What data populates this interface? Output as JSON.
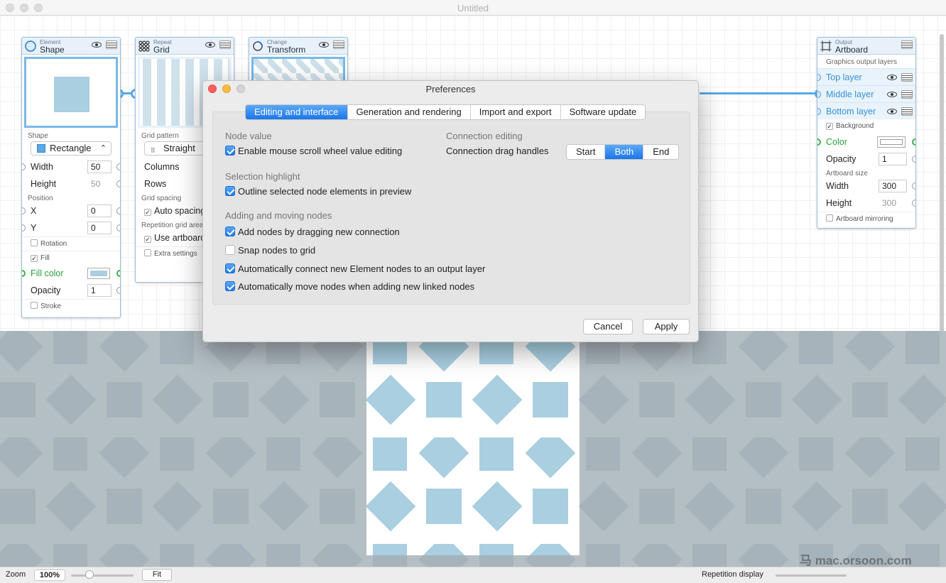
{
  "window": {
    "title": "Untitled"
  },
  "nodes": {
    "shape": {
      "category": "Element",
      "name": "Shape",
      "section_shape": "Shape",
      "shape_value": "Rectangle",
      "width_label": "Width",
      "width_value": "50",
      "height_label": "Height",
      "height_value": "50",
      "section_position": "Position",
      "x_label": "X",
      "x_value": "0",
      "y_label": "Y",
      "y_value": "0",
      "rotation_label": "Rotation",
      "fill_label": "Fill",
      "fill_color_label": "Fill color",
      "opacity_label": "Opacity",
      "opacity_value": "1",
      "stroke_label": "Stroke",
      "accent_color": "#a9cfe0"
    },
    "grid": {
      "category": "Repeat",
      "name": "Grid",
      "section_pattern": "Grid pattern",
      "pattern_value": "Straight",
      "columns_label": "Columns",
      "rows_label": "Rows",
      "section_spacing": "Grid spacing",
      "auto_spacing_label": "Auto spacing",
      "section_repetition": "Repetition grid area",
      "use_artboard_label": "Use artboard",
      "extra_settings_label": "Extra settings"
    },
    "transform": {
      "category": "Change",
      "name": "Transform"
    },
    "artboard": {
      "category": "Output",
      "name": "Artboard",
      "section_layers": "Graphics output layers",
      "layers": [
        "Top layer",
        "Middle layer",
        "Bottom layer"
      ],
      "background_label": "Background",
      "color_label": "Color",
      "opacity_label": "Opacity",
      "opacity_value": "1",
      "section_size": "Artboard size",
      "width_label": "Width",
      "width_value": "300",
      "height_label": "Height",
      "height_value": "300",
      "mirroring_label": "Artboard mirroring"
    }
  },
  "preferences": {
    "title": "Preferences",
    "tabs": [
      "Editing and interface",
      "Generation and rendering",
      "Import and export",
      "Software update"
    ],
    "active_tab": 0,
    "node_value": {
      "heading": "Node value",
      "options": [
        {
          "label": "Enable mouse scroll wheel value editing",
          "checked": true
        }
      ]
    },
    "selection_highlight": {
      "heading": "Selection highlight",
      "options": [
        {
          "label": "Outline selected node elements in preview",
          "checked": true
        }
      ]
    },
    "adding_moving": {
      "heading": "Adding and moving nodes",
      "options": [
        {
          "label": "Add nodes by dragging new connection",
          "checked": true
        },
        {
          "label": "Snap nodes to grid",
          "checked": false
        },
        {
          "label": "Automatically connect new Element nodes to an output layer",
          "checked": true
        },
        {
          "label": "Automatically move nodes when adding new linked nodes",
          "checked": true
        }
      ]
    },
    "connection_editing": {
      "heading": "Connection editing",
      "handles_label": "Connection drag handles",
      "segments": [
        "Start",
        "Both",
        "End"
      ],
      "selected": "Both"
    },
    "cancel_label": "Cancel",
    "apply_label": "Apply",
    "accent_color": "#1f7ae8"
  },
  "statusbar": {
    "zoom_label": "Zoom",
    "zoom_value": "100%",
    "fit_label": "Fit",
    "repetition_label": "Repetition display",
    "watermark": "马 mac.orsoon.com"
  },
  "colors": {
    "tile": "#a9cfe0",
    "tile_bg": "#b4bfc4",
    "connection": "#5aa8e6"
  }
}
